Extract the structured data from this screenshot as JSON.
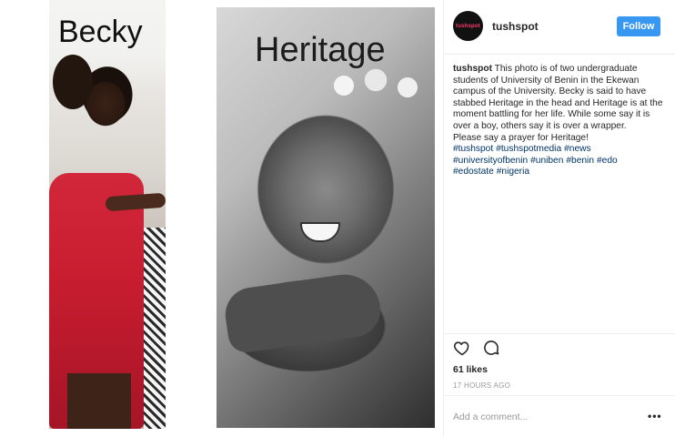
{
  "photo": {
    "left_label": "Becky",
    "right_label": "Heritage"
  },
  "post": {
    "avatar_text": "tushspot",
    "username": "tushspot",
    "follow_label": "Follow",
    "caption_user": "tushspot",
    "caption_text": "This photo is of two undergraduate students of University of Benin in the Ekewan campus of the University. Becky is said to have stabbed Heritage in the head and Heritage is at the moment battling for her life. While some say it is over a boy, others say it is over a wrapper.",
    "caption_prayer": "Please say a prayer for Heritage!",
    "hashtags": [
      "#tushspot",
      "#tushspotmedia",
      "#news",
      "#universityofbenin",
      "#uniben",
      "#benin",
      "#edo",
      "#edostate",
      "#nigeria"
    ],
    "likes": "61 likes",
    "timestamp": "17 HOURS AGO",
    "comment_placeholder": "Add a comment...",
    "more_icon": "more-dots-icon"
  },
  "colors": {
    "follow_button": "#3897f0",
    "hashtag": "#003569",
    "muted": "#999999"
  }
}
